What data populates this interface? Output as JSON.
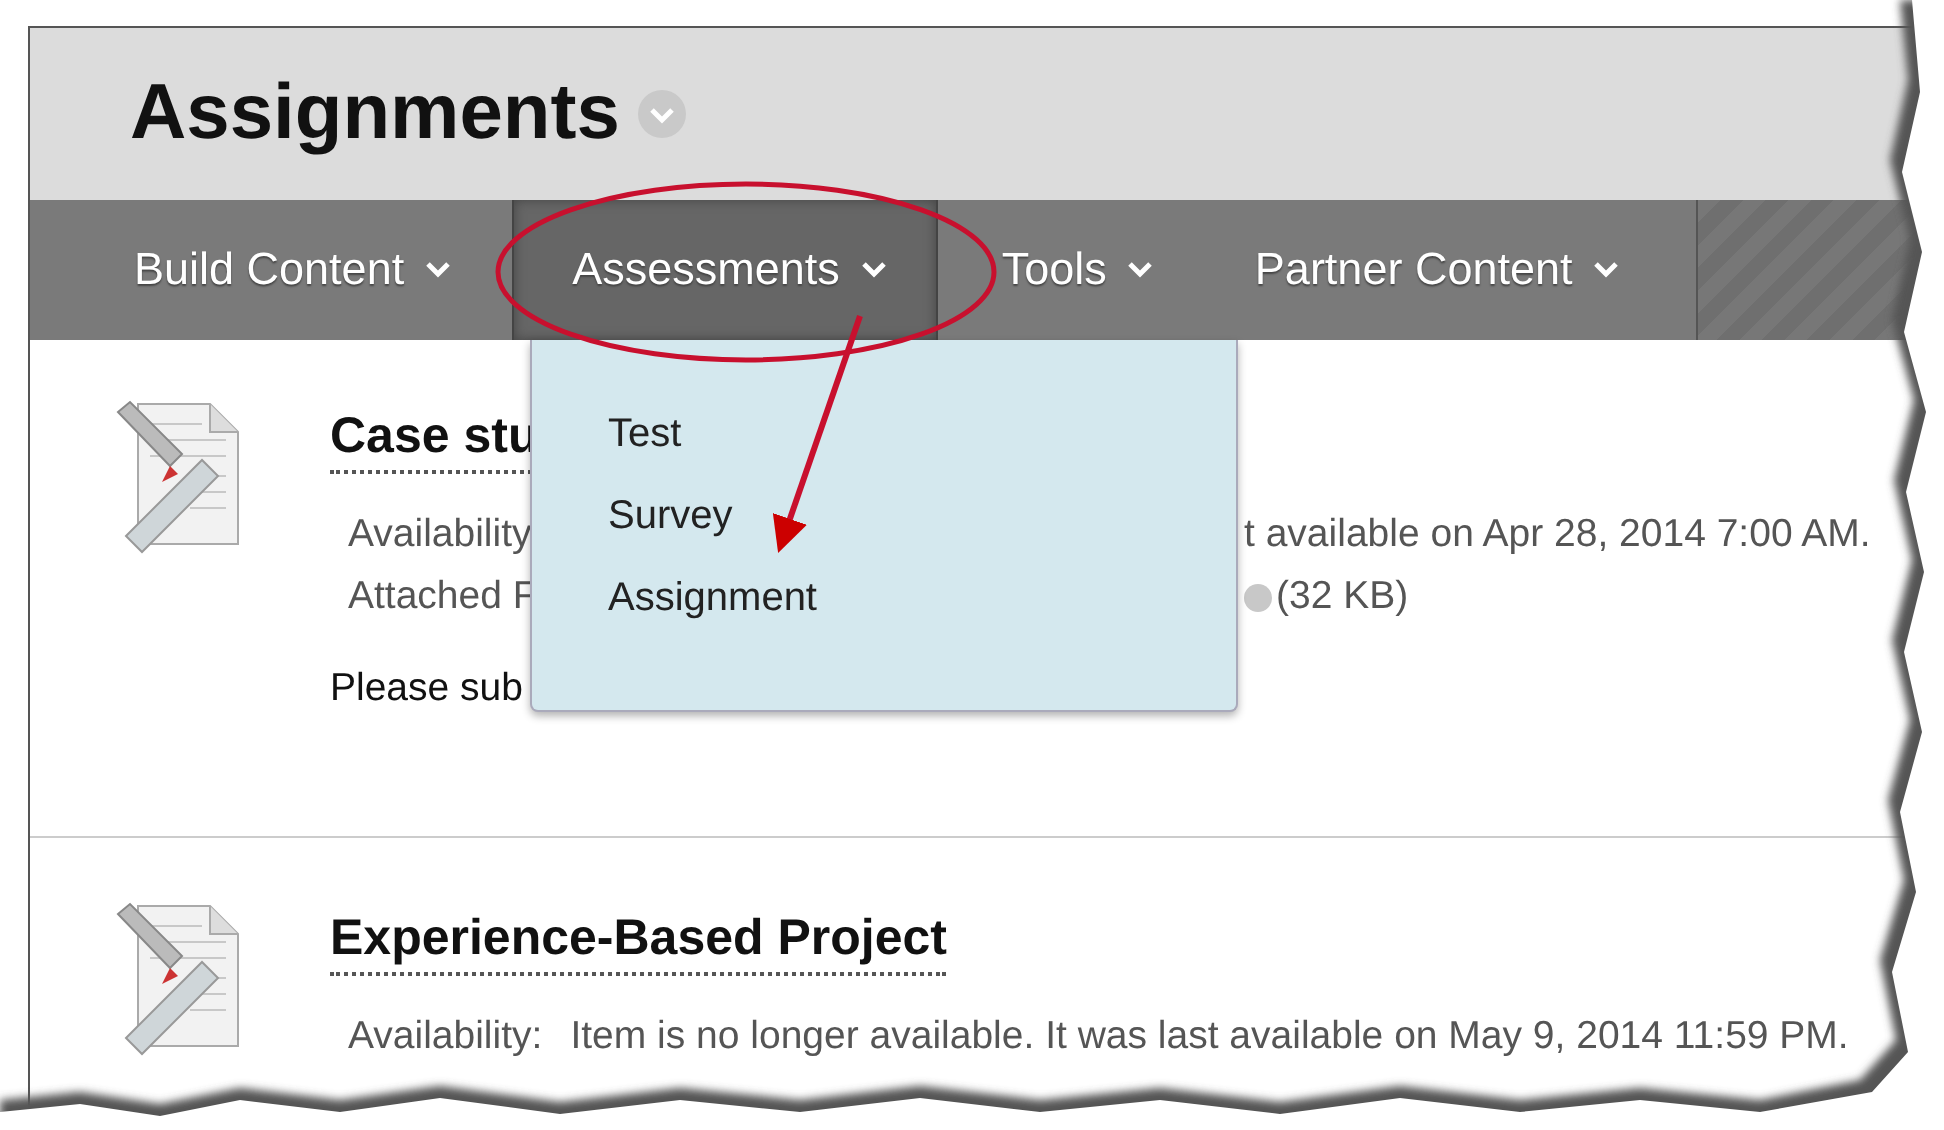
{
  "page": {
    "title": "Assignments"
  },
  "nav": [
    {
      "label": "Build Content",
      "selected": false
    },
    {
      "label": "Assessments",
      "selected": true
    },
    {
      "label": "Tools",
      "selected": false
    },
    {
      "label": "Partner Content",
      "selected": false
    }
  ],
  "dropdown": {
    "items": [
      {
        "label": "Test"
      },
      {
        "label": "Survey"
      },
      {
        "label": "Assignment"
      }
    ]
  },
  "items": [
    {
      "title": "Case stu",
      "lines": [
        {
          "kind": "covered",
          "left": "Availability",
          "right": "t available on Apr 28, 2014 7:00 AM.",
          "file_icon": false
        },
        {
          "kind": "covered",
          "left": "Attached F",
          "right": "(32 KB)",
          "file_icon": true
        }
      ],
      "body": "Please sub"
    },
    {
      "title": "Experience-Based Project",
      "lines": [
        {
          "kind": "plain",
          "left": "Availability:",
          "right": "Item is no longer available. It was last available on May 9, 2014 11:59 PM.",
          "file_icon": false
        }
      ]
    }
  ]
}
